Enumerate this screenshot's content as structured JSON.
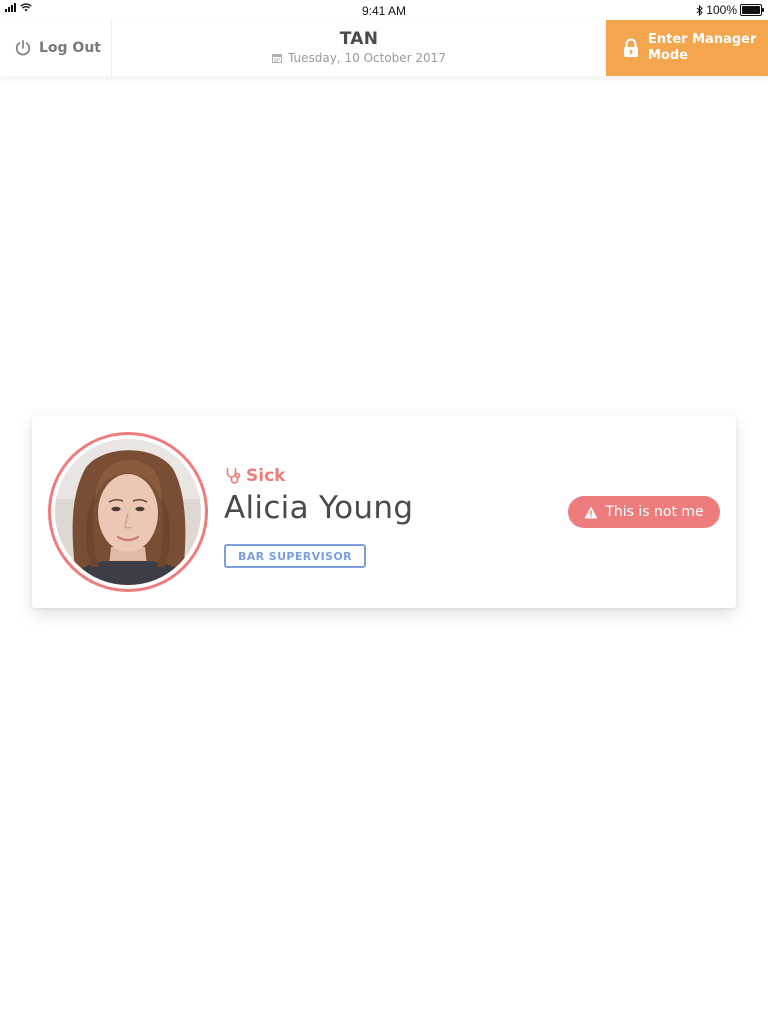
{
  "status_bar": {
    "time": "9:41 AM",
    "battery": "100%",
    "icons": [
      "signal-icon",
      "wifi-icon",
      "bluetooth-icon",
      "battery-icon"
    ]
  },
  "header": {
    "logout_label": "Log Out",
    "location": "TAN",
    "date": "Tuesday, 10 October 2017",
    "manager_label_line1": "Enter Manager",
    "manager_label_line2": "Mode"
  },
  "employee": {
    "status": "Sick",
    "name": "Alicia Young",
    "role": "BAR SUPERVISOR",
    "not_me_label": "This is not me"
  },
  "colors": {
    "accent_orange": "#f4a64f",
    "sick_red": "#ef7c7c",
    "role_blue": "#7b9fdc",
    "text_dark": "#4a4a4a",
    "text_muted": "#9b9b9b"
  }
}
